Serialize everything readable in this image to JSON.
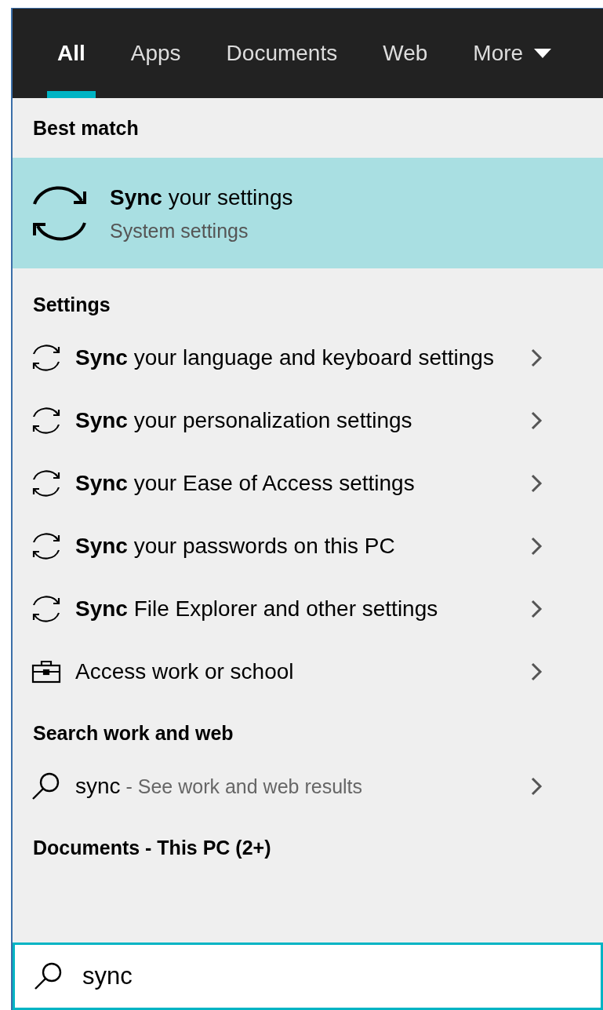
{
  "tabs": [
    {
      "label": "All",
      "selected": true,
      "kind": "plain"
    },
    {
      "label": "Apps",
      "selected": false,
      "kind": "plain"
    },
    {
      "label": "Documents",
      "selected": false,
      "kind": "plain"
    },
    {
      "label": "Web",
      "selected": false,
      "kind": "plain"
    },
    {
      "label": "More",
      "selected": false,
      "kind": "dropdown"
    }
  ],
  "sections": [
    {
      "heading": "Best match",
      "items": [
        {
          "kind": "best",
          "title": "**Sync** your settings",
          "subtitle": "System settings",
          "selected": true
        }
      ]
    },
    {
      "heading": "Settings",
      "items": [
        {
          "kind": "sync",
          "title": "**Sync** your language and keyboard settings",
          "selected": false
        },
        {
          "kind": "sync",
          "title": "**Sync** your personalization settings",
          "selected": false
        },
        {
          "kind": "sync",
          "title": "**Sync** your Ease of Access settings",
          "selected": false
        },
        {
          "kind": "sync",
          "title": "**Sync** your passwords on this PC",
          "selected": false
        },
        {
          "kind": "sync",
          "title": "**Sync** File Explorer and other settings",
          "selected": false
        },
        {
          "kind": "work",
          "title": "Access work or school",
          "selected": false
        }
      ]
    },
    {
      "heading": "Search work and web",
      "items": [
        {
          "kind": "search",
          "title": "sync",
          "detail": "- See work and web results",
          "selected": false
        }
      ]
    },
    {
      "heading": "Documents - This PC (2+)"
    }
  ],
  "search": {
    "value": "sync"
  }
}
